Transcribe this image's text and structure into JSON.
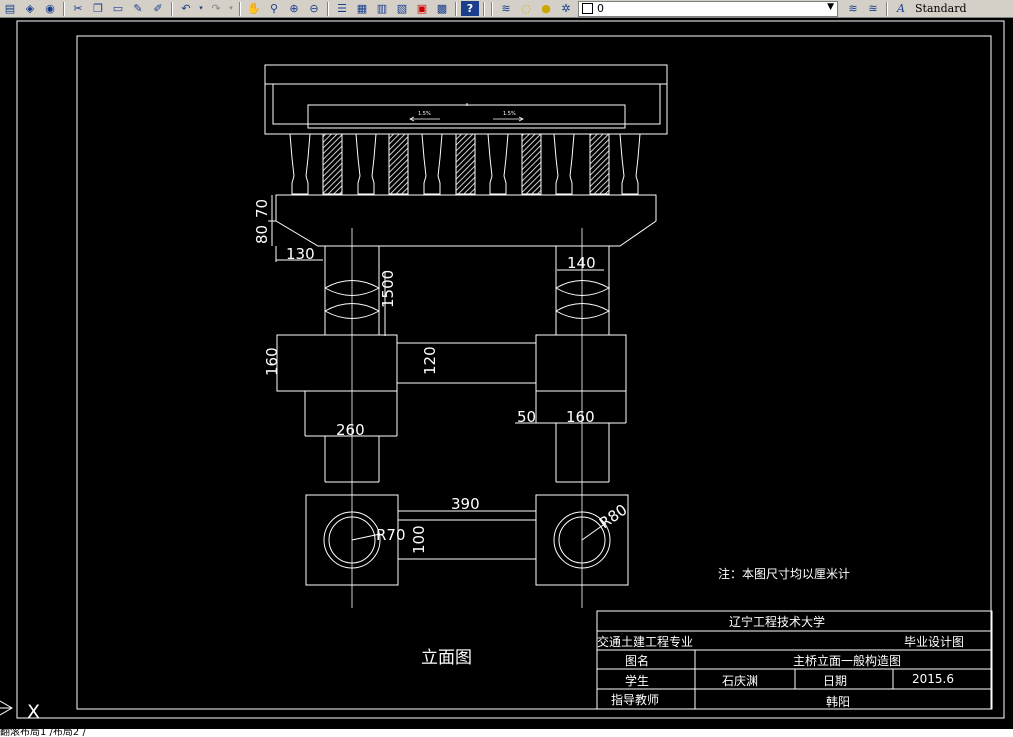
{
  "toolbar": {
    "layer_value": "0",
    "text_style": "Standard",
    "help": "?",
    "icons": [
      "new-icon",
      "open-icon",
      "publish-icon",
      "cut-icon",
      "copy-icon",
      "paste-icon",
      "match-properties-icon",
      "brush-icon",
      "undo-icon",
      "redo-icon",
      "pan-icon",
      "zoom-realtime-icon",
      "zoom-window-icon",
      "zoom-previous-icon",
      "properties-icon",
      "design-center-icon",
      "tool-palettes-icon",
      "sheet-set-icon",
      "markup-icon",
      "calculator-icon",
      "help-icon"
    ]
  },
  "drawing": {
    "dims": {
      "d80": "80",
      "d70": "70",
      "d130": "130",
      "d140": "140",
      "d1500": "1500",
      "d160a": "160",
      "d120": "120",
      "d260": "260",
      "d50": "50",
      "d160b": "160",
      "d390": "390",
      "d100": "100",
      "r70": "R70",
      "r80": "R80"
    },
    "slope_left": "1.5%",
    "slope_right": "1.5%",
    "view_title": "立面图",
    "note": "注：本图尺寸均以厘米计"
  },
  "title_block": {
    "university": "辽宁工程技术大学",
    "major": "交通土建工程专业",
    "design_type": "毕业设计图",
    "figure_label": "图名",
    "figure_name": "主桥立面一般构造图",
    "student_label": "学生",
    "student_name": "石庆渊",
    "date_label": "日期",
    "date_value": "2015.6",
    "teacher_label": "指导教师",
    "teacher_name": "韩阳"
  },
  "ucs": {
    "axis_label": "X"
  },
  "command_line": {
    "text": "翻滚布局1 /布局2 /"
  },
  "colors": {
    "background": "#000000",
    "lines": "#ffffff",
    "toolbar": "#d4d0c8"
  }
}
